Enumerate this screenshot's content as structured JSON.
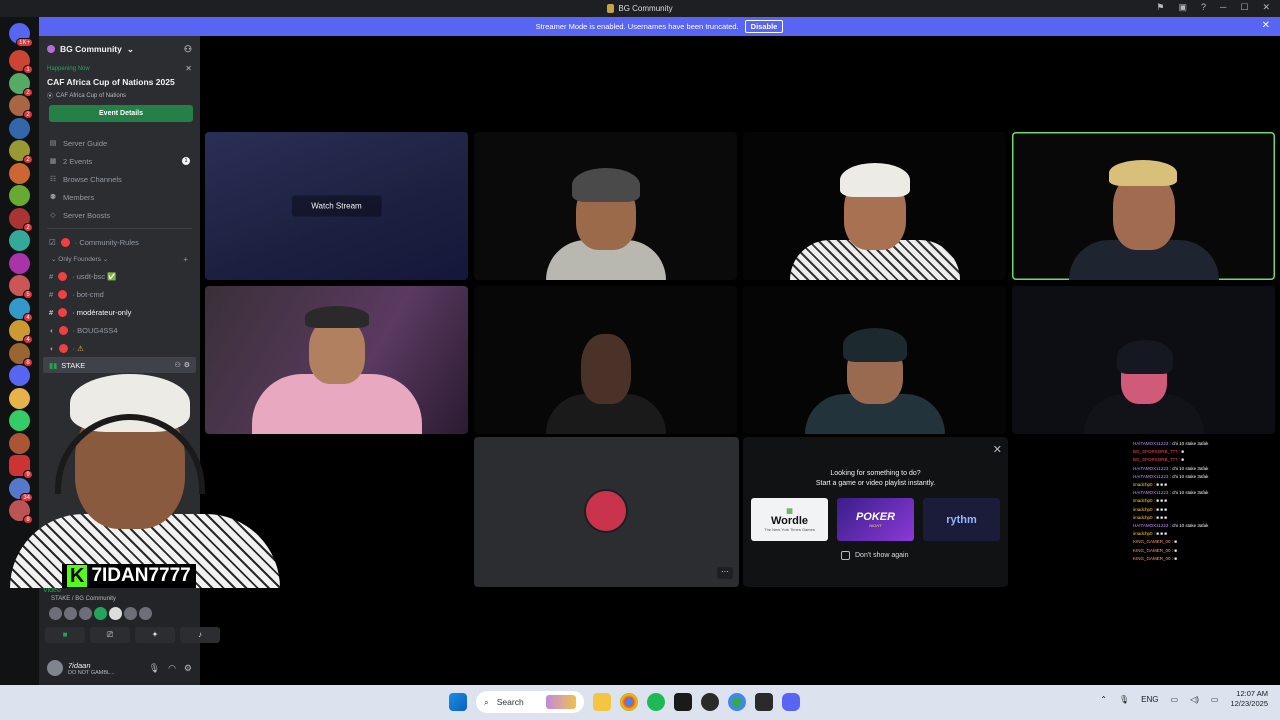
{
  "window": {
    "title": "BG Community"
  },
  "banner": {
    "text": "Streamer Mode is enabled. Usernames have been truncated.",
    "disable_label": "Disable"
  },
  "server_rail": {
    "home_badge": "1K+",
    "badges": [
      "1",
      "2",
      "2",
      "",
      "2",
      "",
      "",
      "2",
      "",
      "",
      "5",
      "4",
      "4",
      "8",
      "",
      "",
      "",
      "",
      "9",
      "34",
      "8"
    ]
  },
  "server": {
    "name": "BG Community"
  },
  "event": {
    "status": "Happening Now",
    "title": "CAF Africa Cup of Nations 2025",
    "location": "CAF Africa Cup of Nations",
    "button_label": "Event Details"
  },
  "nav": [
    {
      "label": "Server Guide",
      "icon": "guide-icon",
      "count": ""
    },
    {
      "label": "2 Events",
      "icon": "calendar-icon",
      "count": "1"
    },
    {
      "label": "Browse Channels",
      "icon": "browse-icon",
      "count": ""
    },
    {
      "label": "Members",
      "icon": "members-icon",
      "count": ""
    },
    {
      "label": "Server Boosts",
      "icon": "boost-icon",
      "count": ""
    }
  ],
  "channels": {
    "rules": "Community-Rules",
    "category": "Only Founders",
    "list": [
      {
        "name": "usdt-bsc",
        "suffix": "✅"
      },
      {
        "name": "bot-cmd",
        "suffix": ""
      },
      {
        "name": "modérateur-only",
        "suffix": ""
      },
      {
        "name": "BOUG4SS4",
        "suffix": ""
      },
      {
        "name": "",
        "suffix": "⚠"
      }
    ],
    "active_voice": "STAKE"
  },
  "rtc": {
    "status": "Video",
    "channel": "STAKE / BG Community"
  },
  "user": {
    "name": "7idaan",
    "status": "DO NOT GAMBL..."
  },
  "stage": {
    "watch_stream_label": "Watch Stream"
  },
  "activities": {
    "prompt_line1": "Looking for something to do?",
    "prompt_line2": "Start a game or video playlist instantly.",
    "wordle_label": "Wordle",
    "wordle_sub": "The New York Times Games",
    "poker_label": "POKER",
    "poker_sub": "NIGHT",
    "rythm_label": "rythm",
    "dont_show_label": "Don't show again"
  },
  "chat_overlay": [
    {
      "user": "HAITAMOX11223 :",
      "msg": "chi 10 stake 3afak",
      "color": "#c98cff"
    },
    {
      "user": "BG_SPORSORB_777 :",
      "msg": "■",
      "color": "#ff4d4d"
    },
    {
      "user": "BG_SPORSORB_777 :",
      "msg": "■",
      "color": "#ff4d4d"
    },
    {
      "user": "HAITAMOX11223 :",
      "msg": "chi 10 stake 3afak",
      "color": "#c98cff"
    },
    {
      "user": "HAITAMOX11223 :",
      "msg": "chi 10 stake 3afak",
      "color": "#c98cff"
    },
    {
      "user": "imadchp0 :",
      "msg": "■ ■ ■",
      "color": "#ffcc33"
    },
    {
      "user": "HAITAMOX11223 :",
      "msg": "chi 10 stake 3afak",
      "color": "#c98cff"
    },
    {
      "user": "imadchp0 :",
      "msg": "■ ■ ■",
      "color": "#ffcc33"
    },
    {
      "user": "imadchp0 :",
      "msg": "■ ■ ■",
      "color": "#ffcc33"
    },
    {
      "user": "imadchp0 :",
      "msg": "■ ■ ■",
      "color": "#ffcc33"
    },
    {
      "user": "HAITAMOX11223 :",
      "msg": "chi 10 stake 3afak",
      "color": "#c98cff"
    },
    {
      "user": "imadchp0 :",
      "msg": "■ ■ ■",
      "color": "#ffcc33"
    },
    {
      "user": "KING_GAMER_00 :",
      "msg": "■",
      "color": "#ff9966"
    },
    {
      "user": "KING_GAMER_00 :",
      "msg": "■",
      "color": "#ff9966"
    },
    {
      "user": "KING_GAMER_00 :",
      "msg": "■",
      "color": "#ff9966"
    }
  ],
  "streamer_tag": "7IDAN7777",
  "taskbar": {
    "search_placeholder": "Search",
    "language": "ENG",
    "time": "12:07 AM",
    "date": "12/23/2025"
  },
  "colors": {
    "accent": "#5865f2",
    "green": "#248046",
    "speaking": "#6bd96b"
  }
}
